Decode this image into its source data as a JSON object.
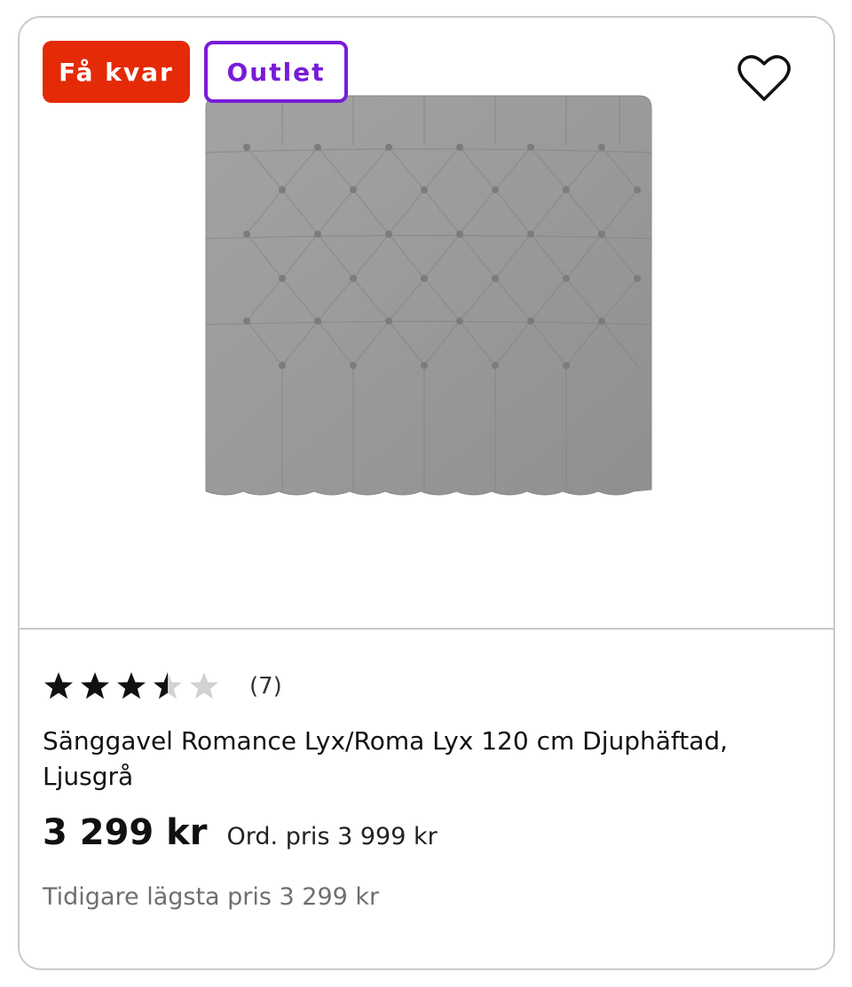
{
  "badges": {
    "few_left": "Få kvar",
    "outlet": "Outlet"
  },
  "colors": {
    "few_left_bg": "#e42a06",
    "outlet": "#7a1bd8",
    "fabric": "#999999"
  },
  "favorite_icon": "heart-outline-icon",
  "product": {
    "image_alt": "headboard-image",
    "rating": {
      "value": 3.5,
      "max": 5,
      "count_label": "(7)"
    },
    "title": "Sänggavel Romance Lyx/Roma Lyx 120 cm Djuphäftad, Ljusgrå",
    "price": "3 299 kr",
    "ordinary_price": "Ord. pris 3 999 kr",
    "lowest_price": "Tidigare lägsta pris 3 299 kr"
  }
}
